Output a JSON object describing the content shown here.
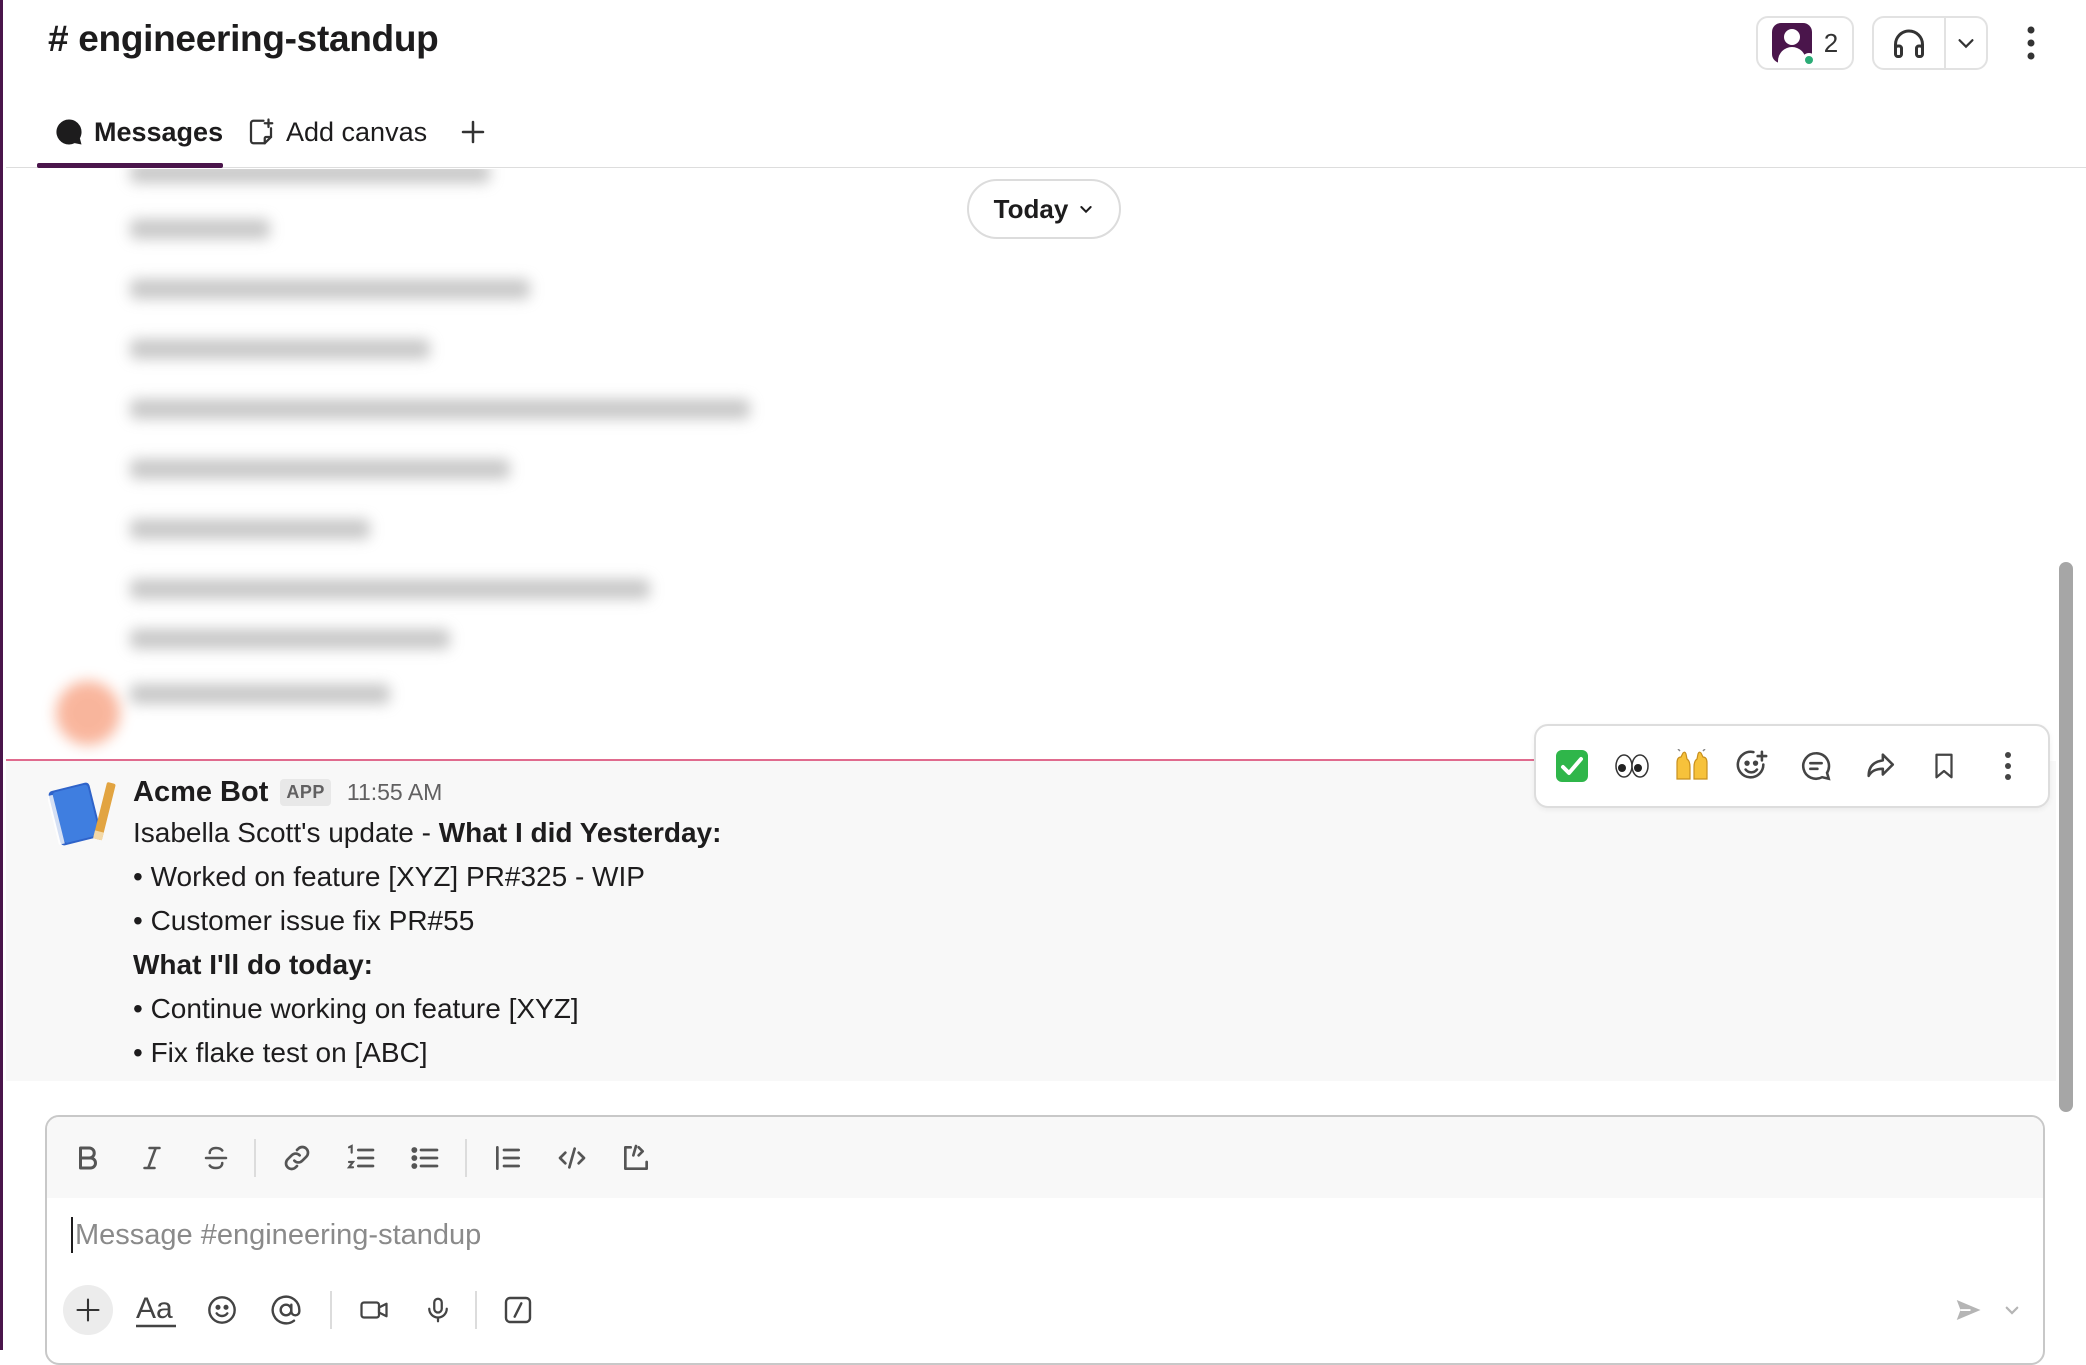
{
  "header": {
    "channel_name": "# engineering-standup",
    "member_count": "2"
  },
  "tabs": [
    {
      "label": "Messages"
    },
    {
      "label": "Add canvas"
    }
  ],
  "date_divider": {
    "label": "Today"
  },
  "message": {
    "author": "Acme Bot",
    "badge": "APP",
    "time": "11:55 AM",
    "lines": [
      {
        "text": "Isabella Scott's update - ",
        "bold": "What I did Yesterday:"
      },
      {
        "text": "• Worked on feature [XYZ] PR#325 - WIP"
      },
      {
        "text": "• Customer issue fix PR#55"
      },
      {
        "bold": "What I'll do today:"
      },
      {
        "text": "• Continue working on feature [XYZ]"
      },
      {
        "text": "• Fix flake test on [ABC]"
      }
    ]
  },
  "hover_actions": {
    "reactions": [
      "✅",
      "👀",
      "🙌"
    ],
    "icons": [
      "add-reaction-icon",
      "reply-thread-icon",
      "forward-icon",
      "bookmark-icon",
      "more-actions-icon"
    ]
  },
  "composer": {
    "placeholder": "Message #engineering-standup",
    "format_tools": [
      "bold",
      "italic",
      "strikethrough",
      "link",
      "ordered-list",
      "bulleted-list",
      "blockquote",
      "code",
      "code-block"
    ],
    "bottom_tools": [
      "attach",
      "formatting",
      "emoji",
      "mention",
      "video",
      "audio",
      "shortcuts",
      "send"
    ]
  },
  "colors": {
    "brand": "#4a154b",
    "new_message_line": "#e06b8e",
    "presence_active": "#2bac76"
  }
}
